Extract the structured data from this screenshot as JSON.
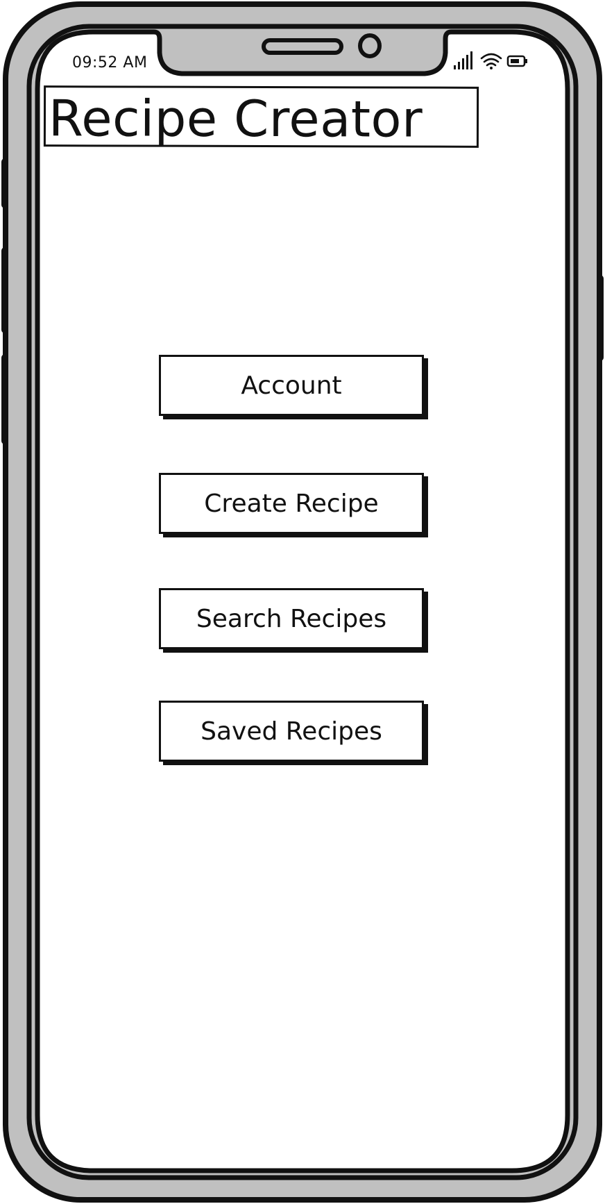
{
  "status_bar": {
    "time": "09:52 AM",
    "icons": [
      "signal-icon",
      "wifi-icon",
      "battery-icon"
    ]
  },
  "header": {
    "title": "Recipe Creator"
  },
  "menu": {
    "account_label": "Account",
    "create_recipe_label": "Create Recipe",
    "search_recipes_label": "Search Recipes",
    "saved_recipes_label": "Saved Recipes"
  },
  "colors": {
    "frame": "#c0c0c0",
    "outline": "#111111",
    "screen": "#ffffff"
  }
}
